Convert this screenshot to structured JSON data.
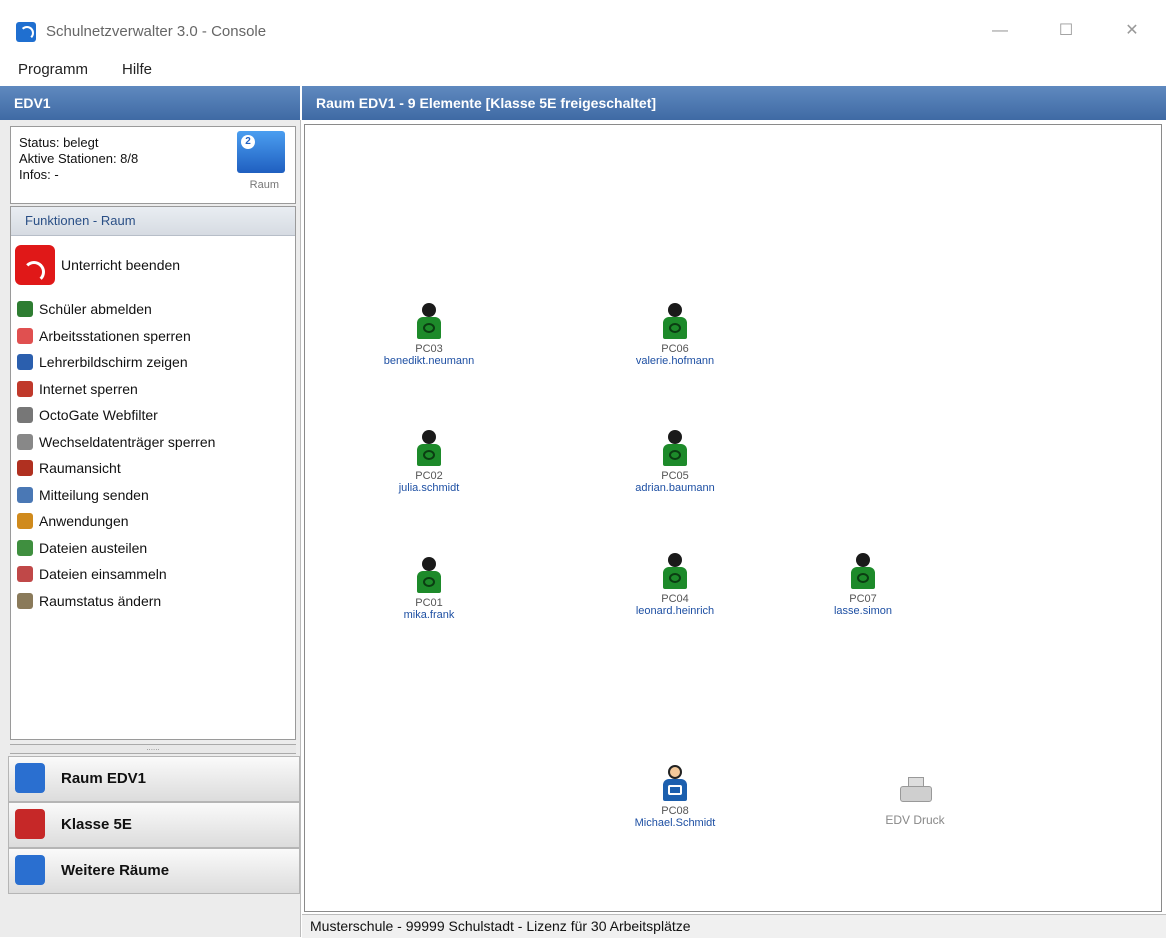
{
  "window": {
    "title": "Schulnetzverwalter 3.0 - Console",
    "minimize": "—",
    "maximize": "☐",
    "close": "✕"
  },
  "menu": [
    "Programm",
    "Hilfe"
  ],
  "left": {
    "header": "EDV1",
    "status": {
      "status": "Status: belegt",
      "stations": "Aktive Stationen: 8/8",
      "infos": "Infos: -",
      "icon_label": "Raum",
      "icon_badge": "2"
    },
    "functions_header": "Funktionen - Raum",
    "primary_action": {
      "label": "Unterricht beenden",
      "icon": "broadcast-icon",
      "color": "#e01818"
    },
    "functions": [
      {
        "label": "Schüler abmelden",
        "icon": "user-logout-icon",
        "color": "#2e7d32"
      },
      {
        "label": "Arbeitsstationen sperren",
        "icon": "lock-station-icon",
        "color": "#e05050"
      },
      {
        "label": "Lehrerbildschirm zeigen",
        "icon": "monitor-icon",
        "color": "#2b5fae"
      },
      {
        "label": "Internet sperren",
        "icon": "globe-block-icon",
        "color": "#c0392b"
      },
      {
        "label": "OctoGate Webfilter",
        "icon": "filter-icon",
        "color": "#777777"
      },
      {
        "label": "Wechseldatenträger sperren",
        "icon": "usb-lock-icon",
        "color": "#888888"
      },
      {
        "label": "Raumansicht",
        "icon": "room-view-icon",
        "color": "#b03020"
      },
      {
        "label": "Mitteilung senden",
        "icon": "message-icon",
        "color": "#4a78b5"
      },
      {
        "label": "Anwendungen",
        "icon": "apps-icon",
        "color": "#d08a1c"
      },
      {
        "label": "Dateien austeilen",
        "icon": "file-send-icon",
        "color": "#3f8f3f"
      },
      {
        "label": "Dateien einsammeln",
        "icon": "file-collect-icon",
        "color": "#c04848"
      },
      {
        "label": "Raumstatus ändern",
        "icon": "room-status-icon",
        "color": "#8a7a5a"
      }
    ],
    "splitter_grip": "......",
    "nav": [
      {
        "label": "Raum EDV1",
        "icon": "room-icon",
        "color": "#2a6fd0"
      },
      {
        "label": "Klasse 5E",
        "icon": "class-icon",
        "color": "#c62828"
      },
      {
        "label": "Weitere Räume",
        "icon": "more-rooms-icon",
        "color": "#2a6fd0"
      }
    ]
  },
  "room": {
    "header": "Raum EDV1 - 9 Elemente [Klasse 5E freigeschaltet]",
    "stations": [
      {
        "pc": "PC03",
        "user": "benedikt.neumann",
        "type": "student"
      },
      {
        "pc": "PC06",
        "user": "valerie.hofmann",
        "type": "student"
      },
      {
        "pc": "PC02",
        "user": "julia.schmidt",
        "type": "student"
      },
      {
        "pc": "PC05",
        "user": "adrian.baumann",
        "type": "student"
      },
      {
        "pc": "PC01",
        "user": "mika.frank",
        "type": "student"
      },
      {
        "pc": "PC04",
        "user": "leonard.heinrich",
        "type": "student"
      },
      {
        "pc": "PC07",
        "user": "lasse.simon",
        "type": "student"
      },
      {
        "pc": "PC08",
        "user": "Michael.Schmidt",
        "type": "teacher"
      }
    ],
    "printer": {
      "label": "EDV Druck",
      "icon": "printer-icon"
    }
  },
  "statusbar": "Musterschule - 99999 Schulstadt - Lizenz für 30 Arbeitsplätze"
}
